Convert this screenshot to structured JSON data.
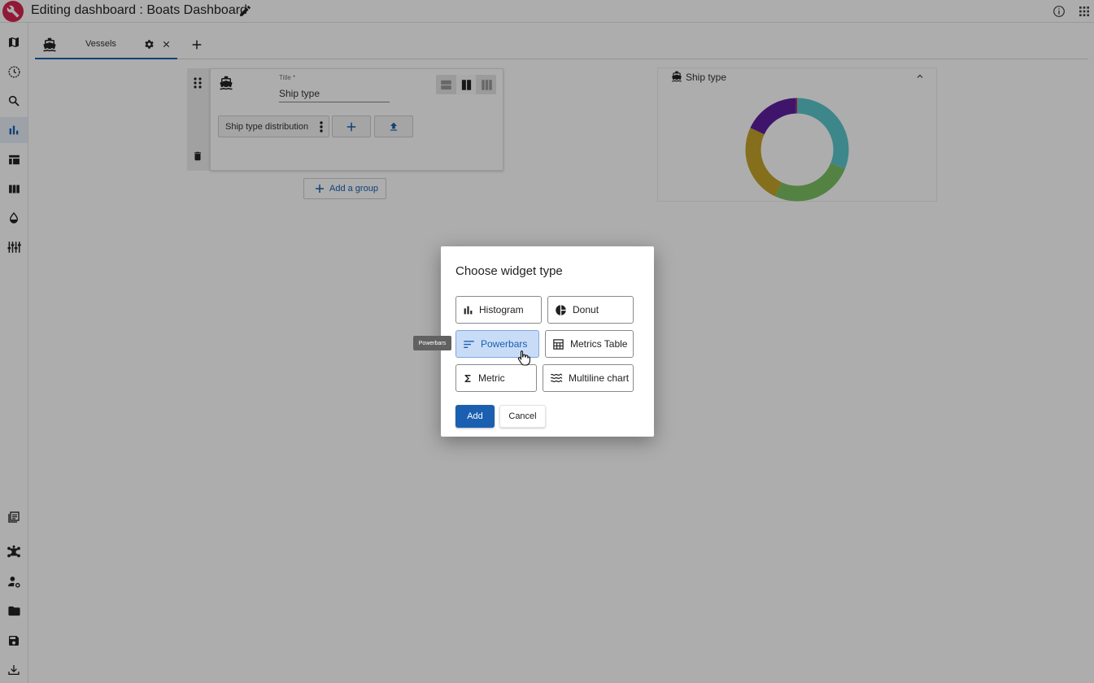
{
  "header": {
    "title": "Editing dashboard : Boats Dashboard"
  },
  "sidebar": {
    "items": [
      {
        "icon": "map-icon"
      },
      {
        "icon": "history-icon"
      },
      {
        "icon": "search-icon"
      },
      {
        "icon": "bar-chart-icon",
        "active": true
      },
      {
        "icon": "table-icon"
      },
      {
        "icon": "columns-icon"
      },
      {
        "icon": "drop-icon"
      },
      {
        "icon": "equalizer-icon"
      },
      {
        "icon": "library-icon"
      },
      {
        "icon": "network-icon"
      },
      {
        "icon": "user-settings-icon"
      },
      {
        "icon": "folder-icon"
      },
      {
        "icon": "save-icon"
      },
      {
        "icon": "download-icon"
      }
    ]
  },
  "tabs": {
    "active_label": "Vessels"
  },
  "group_editor": {
    "title_label": "Title *",
    "title_value": "Ship type",
    "widget_chip_label": "Ship type distribution",
    "add_group_label": "Add a group"
  },
  "preview": {
    "title": "Ship type",
    "chart_data": {
      "type": "pie",
      "donut": true,
      "slices": [
        {
          "value": 30,
          "color": "#5bc8cc"
        },
        {
          "value": 25,
          "color": "#7cc063"
        },
        {
          "value": 24,
          "color": "#c4a22a"
        },
        {
          "value": 17,
          "color": "#5e1fa0"
        },
        {
          "value": 0.5,
          "color": "#d8254f"
        }
      ]
    }
  },
  "dialog": {
    "title": "Choose widget type",
    "options": {
      "histogram": "Histogram",
      "donut": "Donut",
      "powerbars": "Powerbars",
      "metrics_table": "Metrics Table",
      "metric": "Metric",
      "multiline": "Multiline chart"
    },
    "add_label": "Add",
    "cancel_label": "Cancel"
  },
  "tooltip": {
    "text": "Powerbars"
  },
  "colors": {
    "accent": "#1b5fb0",
    "brand": "#d8254f"
  }
}
